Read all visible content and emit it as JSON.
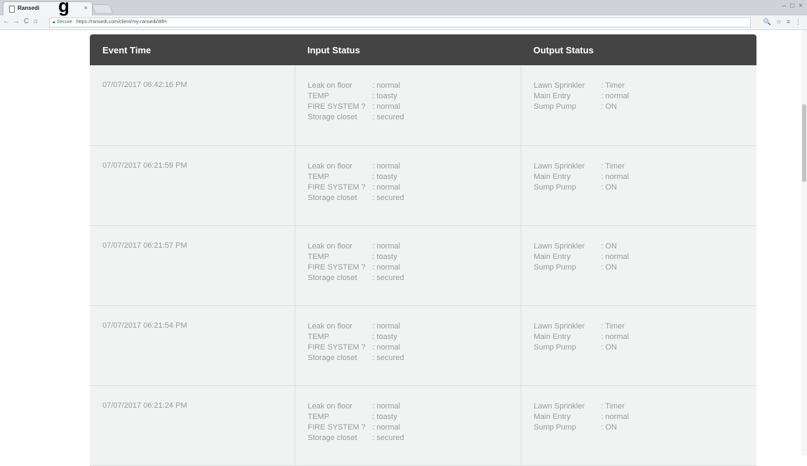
{
  "browser": {
    "tab_title": "Ransedi",
    "tab_close": "×",
    "secure_label": "Secure",
    "url": "https://ransedi.com/client/my-ransedi/i8fH",
    "overlay_text": "g",
    "window_controls": {
      "minimize": "–",
      "maximize": "□",
      "close": "×"
    },
    "nav": {
      "back": "←",
      "forward": "→",
      "reload": "C",
      "home": "⌂"
    },
    "toolbar_icons": {
      "zoom": "🔍",
      "star": "☆",
      "extensions": "≡",
      "menu": "⋮"
    }
  },
  "table": {
    "headers": {
      "event_time": "Event Time",
      "input_status": "Input Status",
      "output_status": "Output Status"
    },
    "input_labels": [
      "Leak on floor",
      "TEMP",
      "FIRE SYSTEM ?",
      "Storage closet"
    ],
    "output_labels": [
      "Lawn Sprinkler",
      "Main Entry",
      "Sump Pump"
    ],
    "rows": [
      {
        "event_time": "07/07/2017  06:42:16 PM",
        "inputs": [
          ": normal",
          ": toasty",
          ": normal",
          ": secured"
        ],
        "outputs": [
          ": Timer",
          ": normal",
          ": ON"
        ]
      },
      {
        "event_time": "07/07/2017  06:21:59 PM",
        "inputs": [
          ": normal",
          ": toasty",
          ": normal",
          ": secured"
        ],
        "outputs": [
          ": Timer",
          ": normal",
          ": ON"
        ]
      },
      {
        "event_time": "07/07/2017  06:21:57 PM",
        "inputs": [
          ": normal",
          ": toasty",
          ": normal",
          ": secured"
        ],
        "outputs": [
          ": ON",
          ": normal",
          ": ON"
        ]
      },
      {
        "event_time": "07/07/2017  06:21:54 PM",
        "inputs": [
          ": normal",
          ": toasty",
          ": normal",
          ": secured"
        ],
        "outputs": [
          ": Timer",
          ": normal",
          ": ON"
        ]
      },
      {
        "event_time": "07/07/2017  06:21:24 PM",
        "inputs": [
          ": normal",
          ": toasty",
          ": normal",
          ": secured"
        ],
        "outputs": [
          ": Timer",
          ": normal",
          ": ON"
        ]
      }
    ]
  },
  "colors": {
    "header_bg": "#444444",
    "row_bg": "#f1f3f3",
    "text_muted": "#9a9a9a"
  }
}
